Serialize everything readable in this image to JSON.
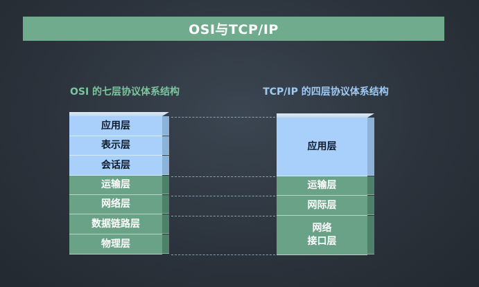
{
  "title": "OSI与TCP/IP",
  "osi": {
    "heading": "OSI 的七层协议体系结构",
    "layers": [
      {
        "name": "应用层",
        "group": "application",
        "color": "#a9d0fa"
      },
      {
        "name": "表示层",
        "group": "application",
        "color": "#a9d0fa"
      },
      {
        "name": "会话层",
        "group": "application",
        "color": "#a9d0fa"
      },
      {
        "name": "运输层",
        "group": "transport",
        "color": "#69a287"
      },
      {
        "name": "网络层",
        "group": "network",
        "color": "#69a287"
      },
      {
        "name": "数据链路层",
        "group": "link",
        "color": "#69a287"
      },
      {
        "name": "物理层",
        "group": "link",
        "color": "#69a287"
      }
    ]
  },
  "tcpip": {
    "heading": "TCP/IP 的四层协议体系结构",
    "layers": [
      {
        "name": "应用层",
        "color": "#a9d0fa"
      },
      {
        "name": "运输层",
        "color": "#69a287"
      },
      {
        "name": "网际层",
        "color": "#69a287"
      },
      {
        "name": "网络\n接口层",
        "color": "#69a287"
      }
    ]
  },
  "colors": {
    "title_bar": "#6fab8c",
    "osi_heading": "#7cc59f",
    "tcp_heading": "#9ecbf5",
    "upper_layer": "#a9d0fa",
    "lower_layer": "#69a287",
    "background": "#2c333c"
  }
}
